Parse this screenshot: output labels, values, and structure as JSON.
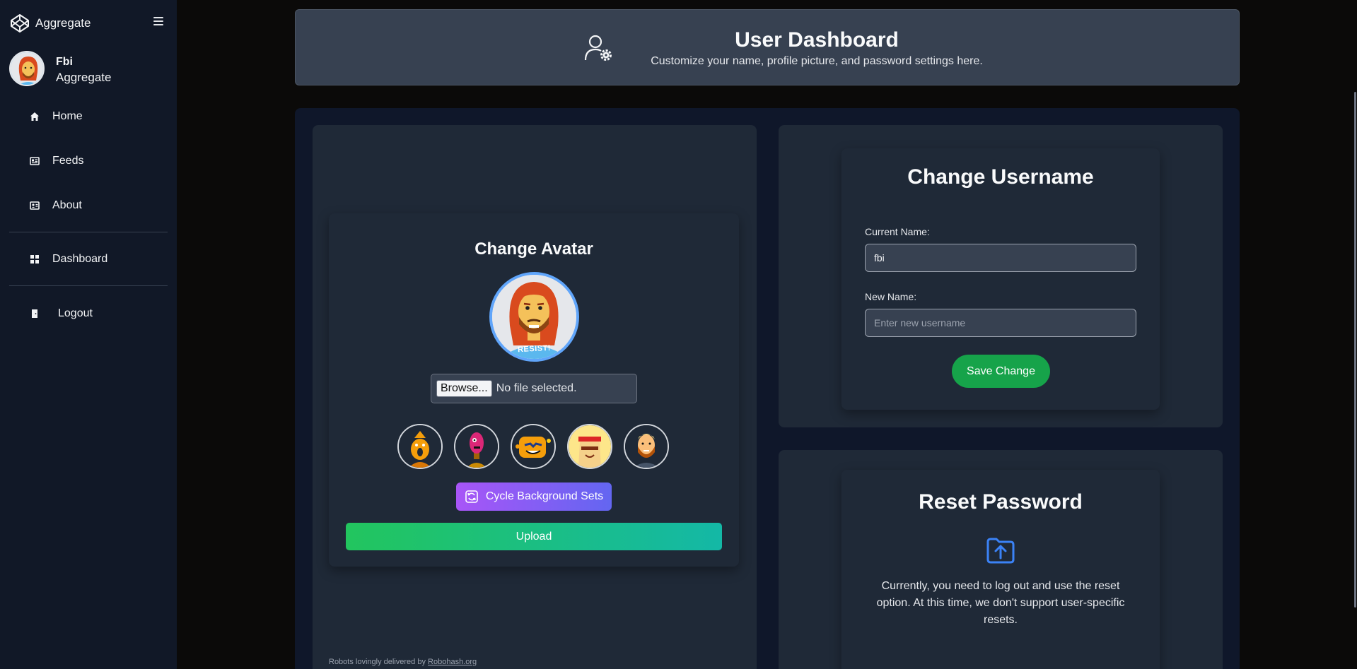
{
  "sidebar": {
    "brand": "Aggregate",
    "user": {
      "name": "Fbi",
      "org": "Aggregate"
    },
    "items": [
      {
        "label": "Home",
        "icon": "home-icon"
      },
      {
        "label": "Feeds",
        "icon": "feeds-icon"
      },
      {
        "label": "About",
        "icon": "about-icon"
      },
      {
        "label": "Dashboard",
        "icon": "dashboard-icon"
      },
      {
        "label": "Logout",
        "icon": "logout-icon"
      }
    ]
  },
  "header": {
    "title": "User Dashboard",
    "subtitle": "Customize your name, profile picture, and password settings here."
  },
  "avatar_card": {
    "title": "Change Avatar",
    "avatar_badge": "RESIST!",
    "browse_label": "Browse...",
    "no_file_text": "No file selected.",
    "cycle_label": "Cycle Background Sets",
    "upload_label": "Upload",
    "credit_prefix": "Robots lovingly delivered by",
    "credit_link": "Robohash.org"
  },
  "username_card": {
    "title": "Change Username",
    "current_label": "Current Name:",
    "current_value": "fbi",
    "new_label": "New Name:",
    "new_placeholder": "Enter new username",
    "save_label": "Save Change"
  },
  "password_card": {
    "title": "Reset Password",
    "text": "Currently, you need to log out and use the reset option. At this time, we don't support user-specific resets."
  },
  "colors": {
    "sidebar_bg": "#111827",
    "card_bg": "#1f2937",
    "accent_blue": "#3b82f6",
    "save_green": "#16a34a"
  }
}
